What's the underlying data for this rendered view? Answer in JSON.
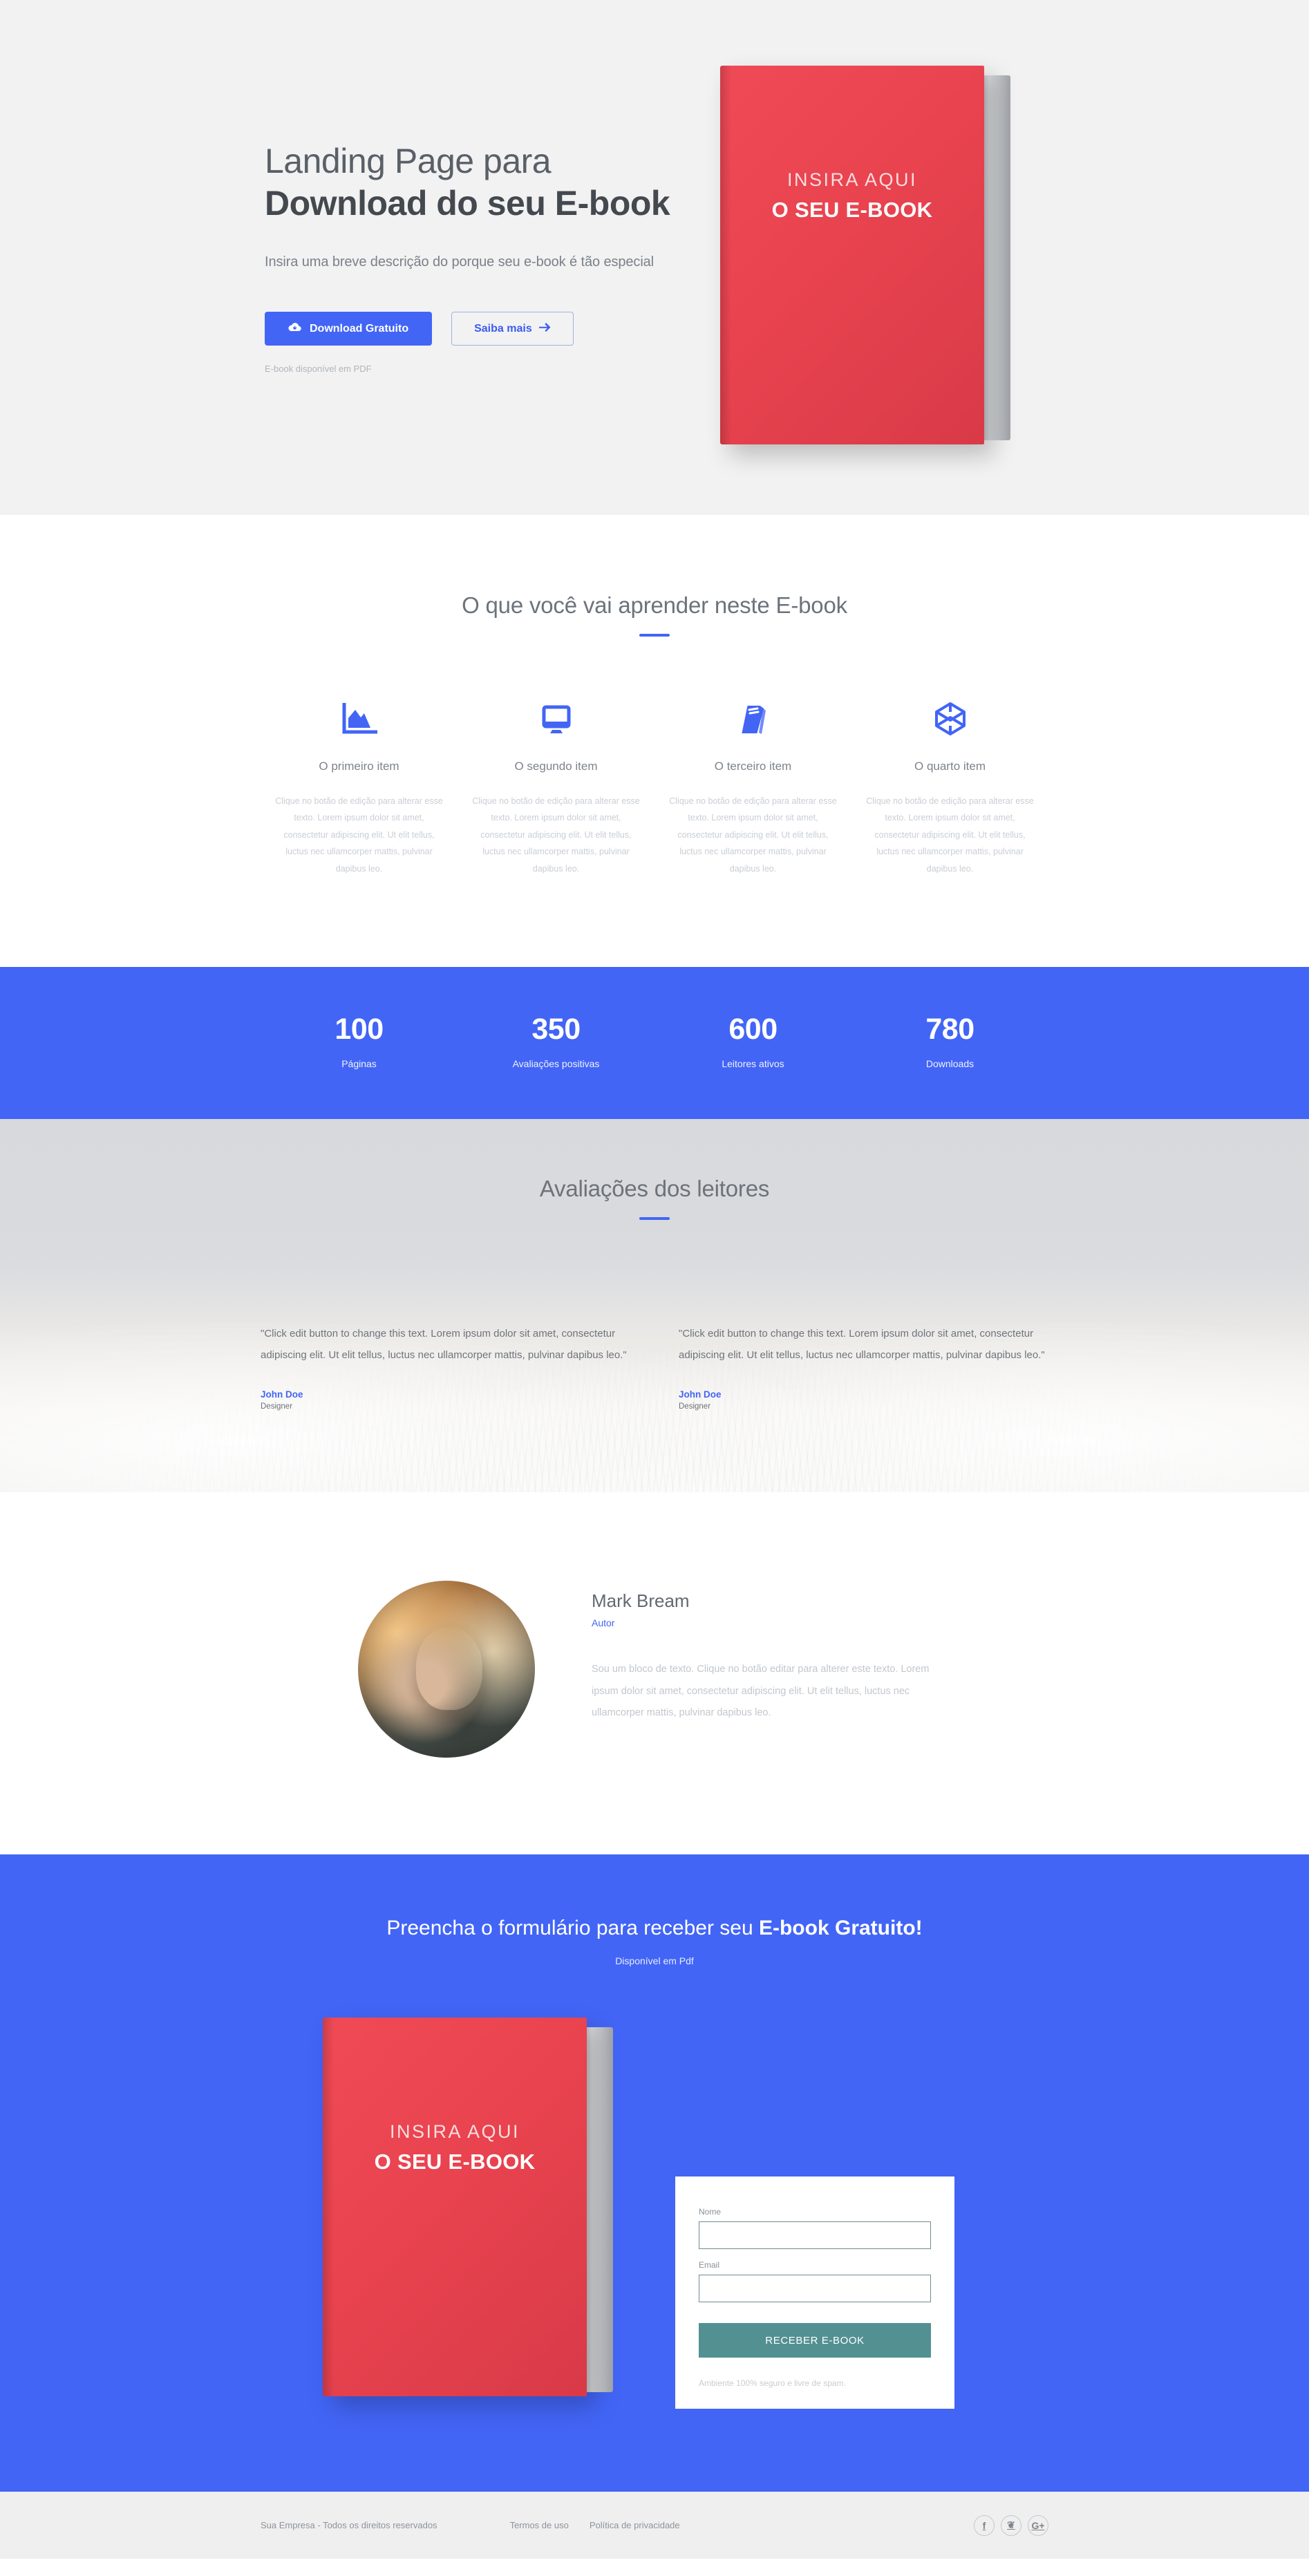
{
  "hero": {
    "title_line1": "Landing Page para",
    "title_line2": "Download do seu E-book",
    "subtitle": "Insira uma breve descrição do porque seu e-book é tão especial",
    "primary_button": "Download Gratuito",
    "secondary_button": "Saiba mais",
    "note": "E-book disponível em PDF",
    "book": {
      "top_text": "INSIRA AQUI",
      "main_text": "O SEU E-BOOK",
      "cover_color": "#e8434f"
    }
  },
  "features": {
    "title": "O que você vai aprender neste E-book",
    "items": [
      {
        "name": "O primeiro item",
        "icon": "area-chart-icon",
        "desc": "Clique no botão de edição para alterar esse texto. Lorem ipsum dolor sit amet, consectetur adipiscing elit. Ut elit tellus, luctus nec ullamcorper mattis, pulvinar dapibus leo."
      },
      {
        "name": "O segundo item",
        "icon": "desktop-monitor-icon",
        "desc": "Clique no botão de edição para alterar esse texto. Lorem ipsum dolor sit amet, consectetur adipiscing elit. Ut elit tellus, luctus nec ullamcorper mattis, pulvinar dapibus leo."
      },
      {
        "name": "O terceiro item",
        "icon": "book-icon",
        "desc": "Clique no botão de edição para alterar esse texto. Lorem ipsum dolor sit amet, consectetur adipiscing elit. Ut elit tellus, luctus nec ullamcorper mattis, pulvinar dapibus leo."
      },
      {
        "name": "O quarto item",
        "icon": "codepen-cube-icon",
        "desc": "Clique no botão de edição para alterar esse texto. Lorem ipsum dolor sit amet, consectetur adipiscing elit. Ut elit tellus, luctus nec ullamcorper mattis, pulvinar dapibus leo."
      }
    ]
  },
  "stats": {
    "accent_color": "#4265f6",
    "items": [
      {
        "value": "100",
        "label": "Páginas"
      },
      {
        "value": "350",
        "label": "Avaliações positivas"
      },
      {
        "value": "600",
        "label": "Leitores ativos"
      },
      {
        "value": "780",
        "label": "Downloads"
      }
    ]
  },
  "testimonials": {
    "title": "Avaliações dos leitores",
    "items": [
      {
        "quote": "\"Click edit button to change this text. Lorem ipsum dolor sit amet, consectetur adipiscing elit. Ut elit tellus, luctus nec ullamcorper mattis, pulvinar dapibus leo.\"",
        "name": "John Doe",
        "role": "Designer"
      },
      {
        "quote": "\"Click edit button to change this text. Lorem ipsum dolor sit amet, consectetur adipiscing elit. Ut elit tellus, luctus nec ullamcorper mattis, pulvinar dapibus leo.\"",
        "name": "John Doe",
        "role": "Designer"
      }
    ]
  },
  "author": {
    "name": "Mark Bream",
    "role": "Autor",
    "bio": "Sou um bloco de texto. Clique no botão editar para alterer este texto. Lorem ipsum dolor sit amet, consectetur adipiscing elit. Ut elit tellus, luctus nec ullamcorper mattis, pulvinar dapibus leo."
  },
  "cta": {
    "title_plain": "Preencha o formulário para receber seu ",
    "title_bold": "E-book Gratuito!",
    "subtitle": "Disponível em Pdf",
    "book": {
      "top_text": "INSIRA AQUI",
      "main_text": "O SEU E-BOOK"
    },
    "form": {
      "name_label": "Nome",
      "name_value": "",
      "email_label": "Email",
      "email_value": "",
      "submit_label": "RECEBER E-BOOK",
      "note": "Ambiente 100% seguro e livre de spam.",
      "submit_color": "#539092"
    }
  },
  "footer": {
    "copyright": "Sua Empresa - Todos os direitos reservados",
    "links": [
      "Termos de uso",
      "Política de privacidade"
    ],
    "social": [
      {
        "name": "facebook-icon",
        "glyph": "f"
      },
      {
        "name": "twitter-icon",
        "glyph": "❦"
      },
      {
        "name": "google-plus-icon",
        "glyph": "G+"
      }
    ]
  }
}
